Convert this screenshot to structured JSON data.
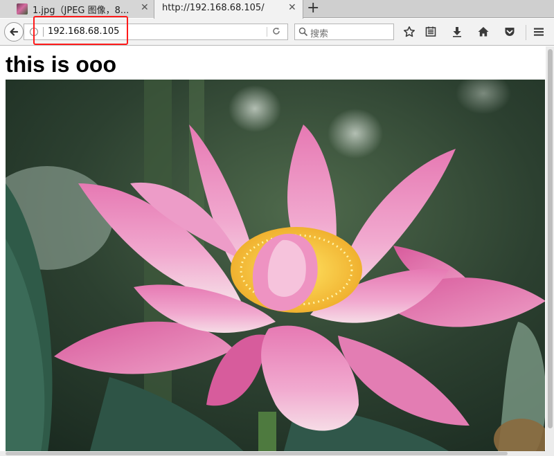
{
  "tabs": [
    {
      "title": "1.jpg（JPEG 图像，8...",
      "favicon": "lotus-thumbnail-icon",
      "active": false
    },
    {
      "title": "http://192.168.68.105/",
      "active": true
    }
  ],
  "tab_close_glyph": "✕",
  "new_tab_glyph": "+",
  "urlbar": {
    "value": "192.168.68.105"
  },
  "search": {
    "placeholder": "搜索"
  },
  "page": {
    "heading": "this is ooo"
  },
  "colors": {
    "highlight": "#ff1a1a",
    "tab_bar": "#cfcfcf",
    "toolbar": "#f2f2f2"
  },
  "icons": [
    "back-arrow-icon",
    "info-icon",
    "reload-icon",
    "search-icon",
    "bookmark-star-icon",
    "reading-list-icon",
    "download-icon",
    "home-icon",
    "pocket-icon",
    "hamburger-menu-icon"
  ]
}
